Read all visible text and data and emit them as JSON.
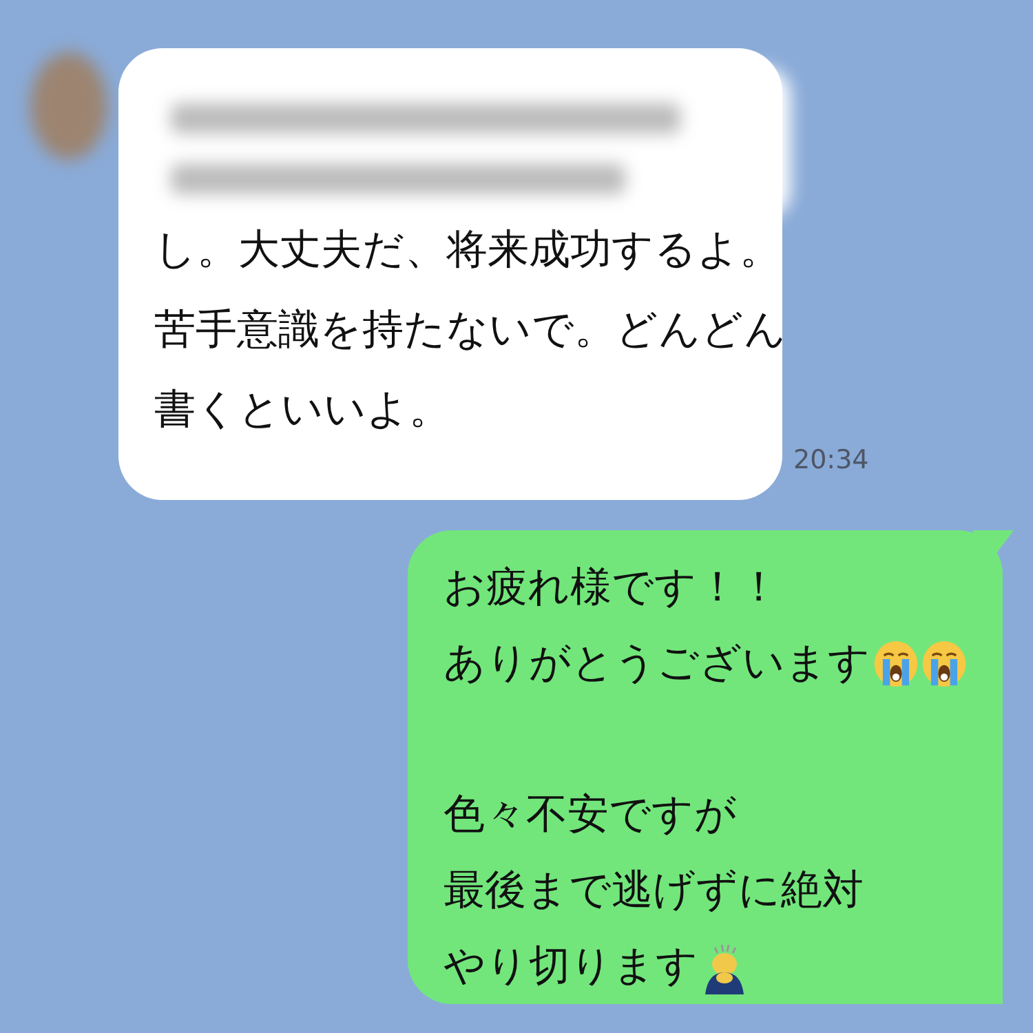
{
  "messages": [
    {
      "kind": "received",
      "blurred": true,
      "avatar": true,
      "lines": [
        {
          "kind": "text",
          "text": "し。大丈夫だ、将来成功するよ。"
        },
        {
          "kind": "text",
          "text": "苦手意識を持たないで。どんどん"
        },
        {
          "kind": "text",
          "text": "書くといいよ。"
        }
      ],
      "time": "20:34"
    },
    {
      "kind": "sent",
      "lines": [
        {
          "kind": "text",
          "text": "お疲れ様です！！"
        },
        {
          "kind": "text",
          "text": "ありがとうございます",
          "emoji": [
            {
              "kind": "crying"
            },
            {
              "kind": "crying"
            }
          ]
        },
        {
          "kind": "blank"
        },
        {
          "kind": "text",
          "text": "色々不安ですが"
        },
        {
          "kind": "text",
          "text": "最後まで逃げずに絶対"
        },
        {
          "kind": "text",
          "text": "やり切ります",
          "emoji": [
            {
              "kind": "bowing"
            }
          ]
        }
      ]
    }
  ]
}
